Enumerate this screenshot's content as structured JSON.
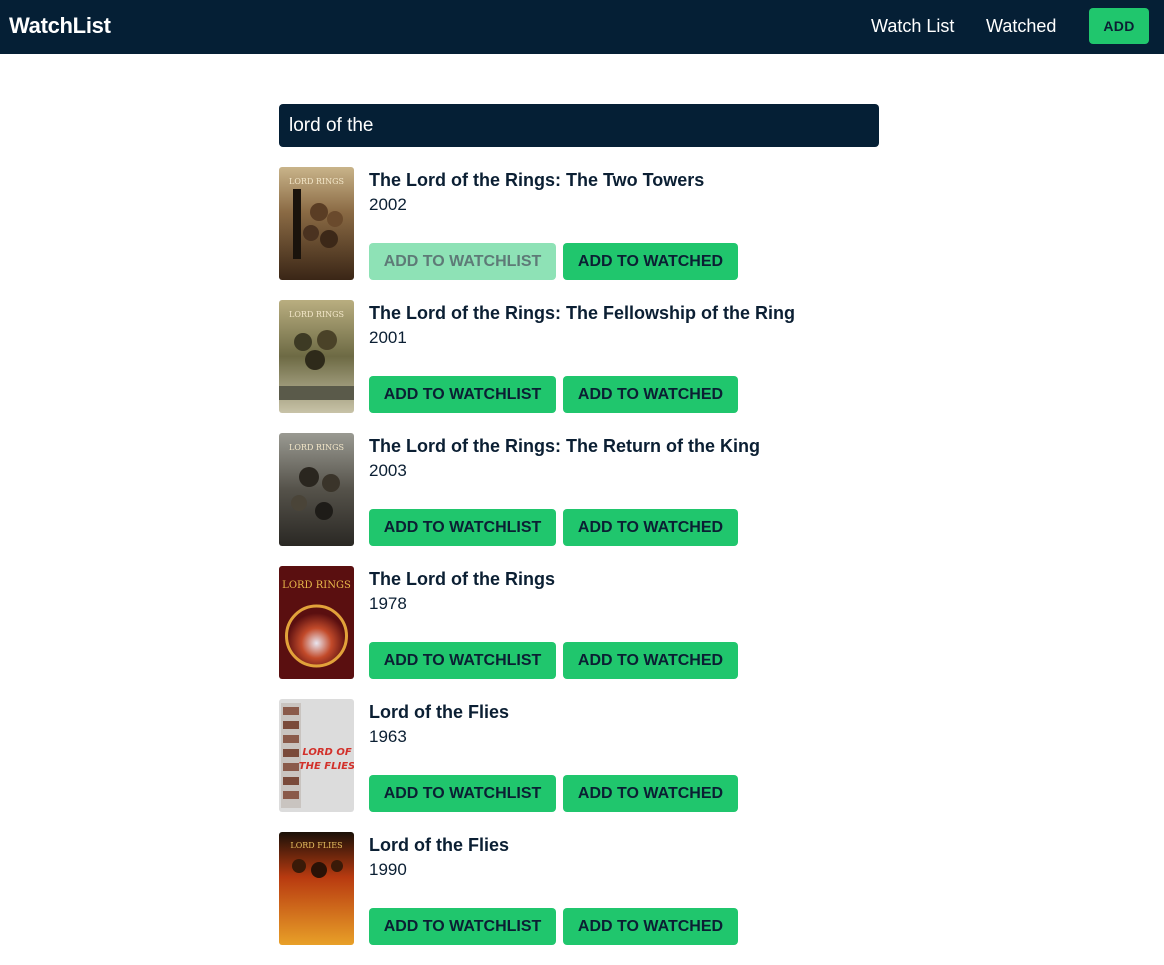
{
  "navbar": {
    "brand": "WatchList",
    "links": [
      "Watch List",
      "Watched"
    ],
    "add_label": "ADD",
    "background": "#051f35",
    "accent": "#20c66d"
  },
  "search": {
    "value": "lord of the",
    "placeholder": ""
  },
  "buttons": {
    "add_to_watchlist": "ADD TO WATCHLIST",
    "add_to_watched": "ADD TO WATCHED"
  },
  "results": [
    {
      "title": "The Lord of the Rings: The Two Towers",
      "year": "2002",
      "watchlist_disabled": true,
      "poster_icon": "lotr-two-towers-poster"
    },
    {
      "title": "The Lord of the Rings: The Fellowship of the Ring",
      "year": "2001",
      "watchlist_disabled": false,
      "poster_icon": "lotr-fellowship-poster"
    },
    {
      "title": "The Lord of the Rings: The Return of the King",
      "year": "2003",
      "watchlist_disabled": false,
      "poster_icon": "lotr-return-king-poster"
    },
    {
      "title": "The Lord of the Rings",
      "year": "1978",
      "watchlist_disabled": false,
      "poster_icon": "lotr-1978-poster"
    },
    {
      "title": "Lord of the Flies",
      "year": "1963",
      "watchlist_disabled": false,
      "poster_icon": "lord-of-flies-1963-poster"
    },
    {
      "title": "Lord of the Flies",
      "year": "1990",
      "watchlist_disabled": false,
      "poster_icon": "lord-of-flies-1990-poster"
    }
  ]
}
